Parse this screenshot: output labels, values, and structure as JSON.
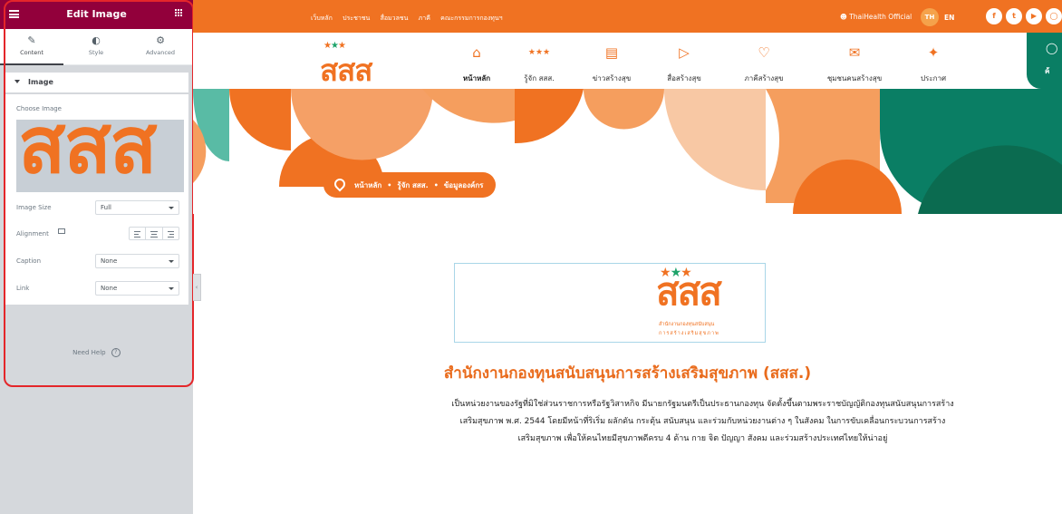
{
  "editor": {
    "title": "Edit Image",
    "tabs": [
      {
        "label": "Content",
        "icon": "pencil-icon"
      },
      {
        "label": "Style",
        "icon": "half-circle-icon"
      },
      {
        "label": "Advanced",
        "icon": "gear-icon"
      }
    ],
    "section_title": "Image",
    "choose_image_label": "Choose Image",
    "image_size_label": "Image Size",
    "image_size_value": "Full",
    "alignment_label": "Alignment",
    "caption_label": "Caption",
    "caption_value": "None",
    "link_label": "Link",
    "link_value": "None",
    "need_help": "Need Help",
    "help_symbol": "?",
    "preview_text": "สสส"
  },
  "site": {
    "top_links": [
      "เว็บหลัก",
      "ประชาชน",
      "สื่อมวลชน",
      "ภาคี",
      "คณะกรรมการกองทุนฯ"
    ],
    "official": "ThaiHealth Official",
    "lang_th": "TH",
    "lang_en": "EN",
    "logo_text": "สสส",
    "nav": [
      {
        "label": "หน้าหลัก",
        "icon": "home-icon"
      },
      {
        "label": "รู้จัก สสส.",
        "icon": "stars-icon"
      },
      {
        "label": "ข่าวสร้างสุข",
        "icon": "news-icon"
      },
      {
        "label": "สื่อสร้างสุข",
        "icon": "media-icon"
      },
      {
        "label": "ภาคีสร้างสุข",
        "icon": "heart-icon"
      },
      {
        "label": "ชุมชนคนสร้างสุข",
        "icon": "chat-icon"
      },
      {
        "label": "ประกาศ",
        "icon": "megaphone-icon"
      }
    ],
    "search_partial": "ค้",
    "breadcrumb": [
      "หน้าหลัก",
      "รู้จัก สสส.",
      "ข้อมูลองค์กร"
    ],
    "logo_sub1": "สำนักงานกองทุนสนับสนุน",
    "logo_sub2": "การสร้างเสริมสุขภาพ",
    "org_title": "สำนักงานกองทุนสนับสนุนการสร้างเสริมสุขภาพ (สสส.)",
    "org_desc": "เป็นหน่วยงานของรัฐที่มิใช่ส่วนราชการหรือรัฐวิสาหกิจ มีนายกรัฐมนตรีเป็นประธานกองทุน จัดตั้งขึ้นตามพระราชบัญญัติกองทุนสนับสนุนการสร้างเสริมสุขภาพ พ.ศ. 2544 โดยมีหน้าที่ริเริ่ม ผลักดัน กระตุ้น สนับสนุน และร่วมกับหน่วยงานต่าง ๆ ในสังคม ในการขับเคลื่อนกระบวนการสร้างเสริมสุขภาพ เพื่อให้คนไทยมีสุขภาพดีครบ 4 ด้าน กาย จิต ปัญญา สังคม และร่วมสร้างประเทศไทยให้น่าอยู่"
  },
  "colors": {
    "brand_orange": "#f07222",
    "brand_green": "#0a7e64",
    "editor_header": "#92003b",
    "highlight": "#e4262a"
  }
}
